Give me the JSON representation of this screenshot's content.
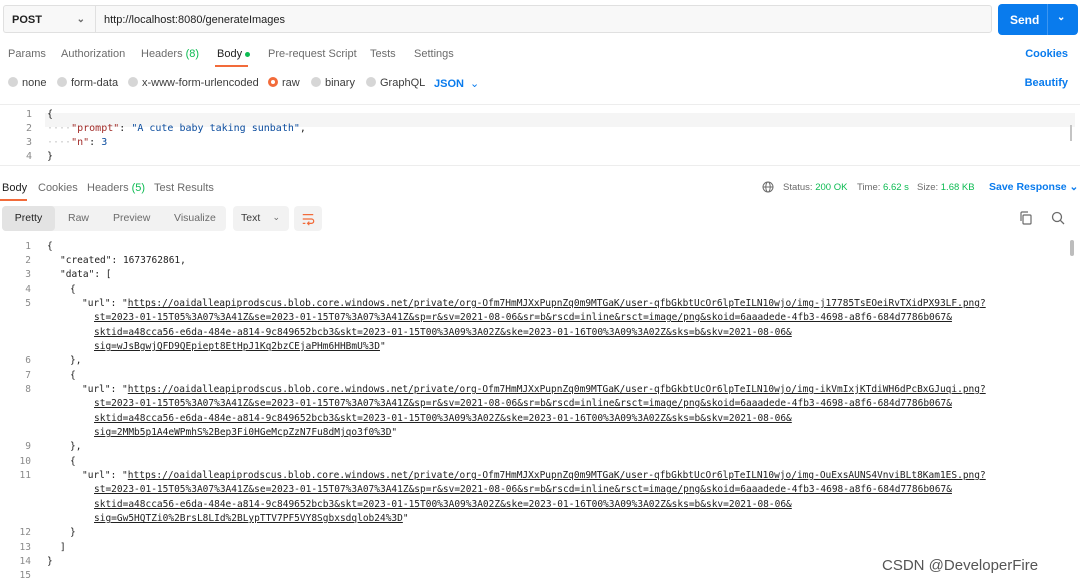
{
  "request": {
    "method": "POST",
    "url": "http://localhost:8080/generateImages",
    "send_label": "Send"
  },
  "request_tabs": {
    "params": "Params",
    "authorization": "Authorization",
    "headers": "Headers",
    "headers_count": "(8)",
    "body": "Body",
    "prerequest": "Pre-request Script",
    "tests": "Tests",
    "settings": "Settings",
    "cookies": "Cookies"
  },
  "body_types": {
    "none": "none",
    "form_data": "form-data",
    "urlencoded": "x-www-form-urlencoded",
    "raw": "raw",
    "binary": "binary",
    "graphql": "GraphQL",
    "format": "JSON",
    "beautify": "Beautify",
    "selected": "raw"
  },
  "request_editor": {
    "line_numbers": [
      "1",
      "2",
      "3",
      "4"
    ],
    "open": "{",
    "key1": "\"prompt\"",
    "val1": "\"A cute baby taking sunbath\"",
    "key2": "\"n\"",
    "val2": "3",
    "close": "}"
  },
  "response_tabs": {
    "body": "Body",
    "cookies": "Cookies",
    "headers": "Headers",
    "headers_count": "(5)",
    "test_results": "Test Results",
    "status_label": "Status:",
    "status_value": "200 OK",
    "time_label": "Time:",
    "time_value": "6.62 s",
    "size_label": "Size:",
    "size_value": "1.68 KB",
    "save_response": "Save Response"
  },
  "response_toolbar": {
    "pretty": "Pretty",
    "raw": "Raw",
    "preview": "Preview",
    "visualize": "Visualize",
    "format": "Text"
  },
  "response_body": {
    "line_numbers": [
      "1",
      "2",
      "3",
      "4",
      "5",
      "6",
      "7",
      "8",
      "9",
      "10",
      "11",
      "12",
      "13",
      "14",
      "15"
    ],
    "open": "{",
    "created_key": "\"created\"",
    "created_val": "1673762861",
    "data_key": "\"data\"",
    "items": [
      {
        "url_key": "\"url\"",
        "url_lines": [
          "https://oaidalleapiprodscus.blob.core.windows.net/private/org-Ofm7HmMJXxPupnZq0m9MTGaK/user-qfbGkbtUcOr6lpTeILN10wjo/img-j17785TsEOeiRvTXidPX93LF.png?",
          "st=2023-01-15T05%3A07%3A41Z&se=2023-01-15T07%3A07%3A41Z&sp=r&sv=2021-08-06&sr=b&rscd=inline&rsct=image/png&skoid=6aaadede-4fb3-4698-a8f6-684d7786b067&",
          "sktid=a48cca56-e6da-484e-a814-9c849652bcb3&skt=2023-01-15T00%3A09%3A02Z&ske=2023-01-16T00%3A09%3A02Z&sks=b&skv=2021-08-06&",
          "sig=wJsBgwjQFD9QEpiept8EtHpJ1Kq2bzCEjaPHm6HHBmU%3D"
        ]
      },
      {
        "url_key": "\"url\"",
        "url_lines": [
          "https://oaidalleapiprodscus.blob.core.windows.net/private/org-Ofm7HmMJXxPupnZq0m9MTGaK/user-qfbGkbtUcOr6lpTeILN10wjo/img-ikVmIxjKTdiWH6dPcBxGJuqi.png?",
          "st=2023-01-15T05%3A07%3A41Z&se=2023-01-15T07%3A07%3A41Z&sp=r&sv=2021-08-06&sr=b&rscd=inline&rsct=image/png&skoid=6aaadede-4fb3-4698-a8f6-684d7786b067&",
          "sktid=a48cca56-e6da-484e-a814-9c849652bcb3&skt=2023-01-15T00%3A09%3A02Z&ske=2023-01-16T00%3A09%3A02Z&sks=b&skv=2021-08-06&",
          "sig=2MMb5p1A4eWPmhS%2Bep3Fi0HGeMcpZzN7Fu8dMjqo3f0%3D"
        ]
      },
      {
        "url_key": "\"url\"",
        "url_lines": [
          "https://oaidalleapiprodscus.blob.core.windows.net/private/org-Ofm7HmMJXxPupnZq0m9MTGaK/user-qfbGkbtUcOr6lpTeILN10wjo/img-OuExsAUNS4VnviBLt8Kam1ES.png?",
          "st=2023-01-15T05%3A07%3A41Z&se=2023-01-15T07%3A07%3A41Z&sp=r&sv=2021-08-06&sr=b&rscd=inline&rsct=image/png&skoid=6aaadede-4fb3-4698-a8f6-684d7786b067&",
          "sktid=a48cca56-e6da-484e-a814-9c849652bcb3&skt=2023-01-15T00%3A09%3A02Z&ske=2023-01-16T00%3A09%3A02Z&sks=b&skv=2021-08-06&",
          "sig=Gw5HQTZi0%2BrsL8LId%2BLypTTV7PF5VY8Sgbxsdqlob24%3D"
        ]
      }
    ]
  },
  "watermark": "CSDN @DeveloperFire",
  "colors": {
    "accent": "#097bed",
    "active_tab": "#f26b3a",
    "status_ok": "#0cbb52"
  }
}
